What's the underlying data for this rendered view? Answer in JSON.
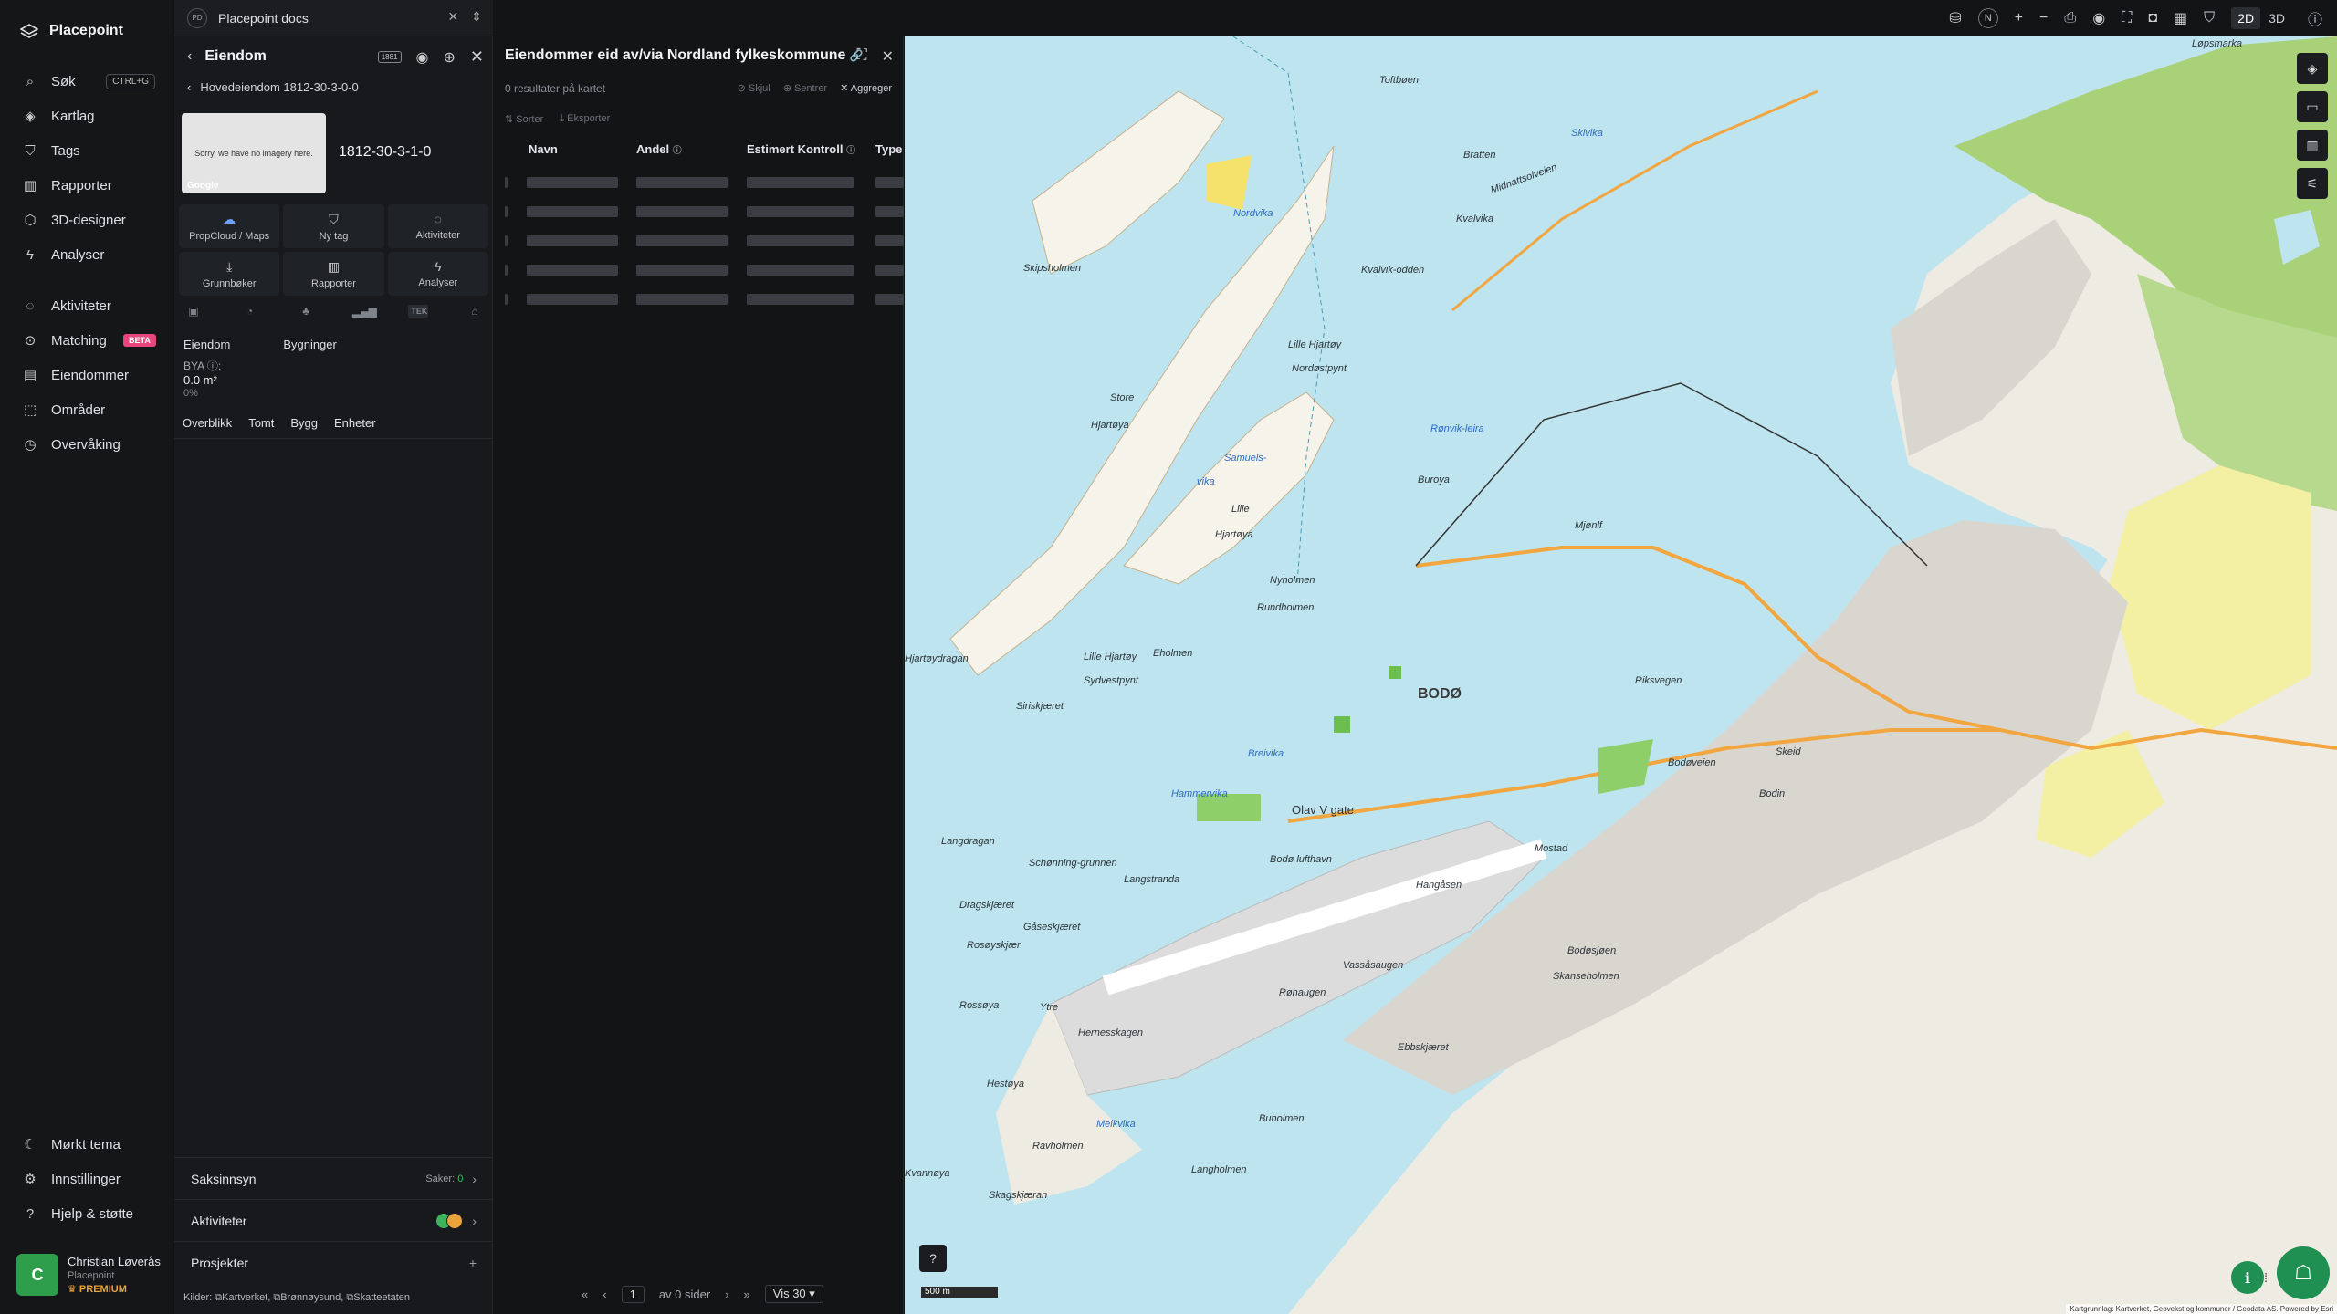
{
  "app": {
    "name": "Placepoint"
  },
  "sidebar": {
    "items": [
      {
        "label": "Søk",
        "icon": "search-icon",
        "shortcut": "CTRL+G"
      },
      {
        "label": "Kartlag",
        "icon": "layers-icon"
      },
      {
        "label": "Tags",
        "icon": "bookmark-icon"
      },
      {
        "label": "Rapporter",
        "icon": "chart-icon"
      },
      {
        "label": "3D-designer",
        "icon": "cube-icon"
      },
      {
        "label": "Analyser",
        "icon": "bolt-icon"
      },
      {
        "label": "Aktiviteter",
        "icon": "chat-icon"
      },
      {
        "label": "Matching",
        "icon": "match-icon",
        "badge": "BETA"
      },
      {
        "label": "Eiendommer",
        "icon": "building-icon"
      },
      {
        "label": "Områder",
        "icon": "area-icon"
      },
      {
        "label": "Overvåking",
        "icon": "monitor-icon"
      }
    ],
    "bottom": [
      {
        "label": "Mørkt tema",
        "icon": "moon-icon"
      },
      {
        "label": "Innstillinger",
        "icon": "gear-icon"
      },
      {
        "label": "Hjelp & støtte",
        "icon": "help-icon"
      }
    ],
    "user": {
      "initial": "C",
      "name": "Christian Løverås",
      "org": "Placepoint",
      "plan": "PREMIUM"
    }
  },
  "tab": {
    "badge": "PD",
    "title": "Placepoint docs"
  },
  "property": {
    "title": "Eiendom",
    "tag": "1881",
    "breadcrumb": "Hovedeiendom 1812-30-3-0-0",
    "thumbnail_text": "Sorry, we have no imagery here.",
    "thumbnail_brand": "Google",
    "id": "1812-30-3-1-0",
    "actions": [
      {
        "label": "PropCloud / Maps",
        "icon": "cloud-icon"
      },
      {
        "label": "Ny tag",
        "icon": "bookmark-icon"
      },
      {
        "label": "Aktiviteter",
        "icon": "chat-icon"
      },
      {
        "label": "Grunnbøker",
        "icon": "download-icon"
      },
      {
        "label": "Rapporter",
        "icon": "chart-icon"
      },
      {
        "label": "Analyser",
        "icon": "bolt-icon"
      }
    ],
    "icon_row_tek": "TEK",
    "section_eiendom": "Eiendom",
    "section_bygninger": "Bygninger",
    "bya_label": "BYA",
    "bya_value": "0.0 m²",
    "bya_percent": "0%",
    "subtabs": [
      "Overblikk",
      "Tomt",
      "Bygg",
      "Enheter"
    ],
    "sections": {
      "saksinnsyn": {
        "label": "Saksinnsyn",
        "meta_label": "Saker:",
        "meta_value": "0"
      },
      "aktiviteter": {
        "label": "Aktiviteter"
      },
      "prosjekter": {
        "label": "Prosjekter"
      }
    },
    "sources_label": "Kilder:",
    "sources": [
      "Kartverket,",
      "Brønnøysund,",
      "Skatteetaten"
    ]
  },
  "list": {
    "title": "Eiendommer eid av/via Nordland fylkeskommune",
    "count": "0 resultater på kartet",
    "tools": [
      "Skjul",
      "Sentrer",
      "Aggreger"
    ],
    "tools2": [
      "Sorter",
      "Eksporter"
    ],
    "columns": [
      "Navn",
      "Andel",
      "Estimert Kontroll",
      "Type"
    ],
    "pager": {
      "page": "1",
      "of": "av 0 sider",
      "show": "Vis 30"
    }
  },
  "map": {
    "mode_2d": "2D",
    "mode_3d": "3D",
    "north": "N",
    "city": "BODØ",
    "scale": "500 m",
    "labels": [
      {
        "t": "Toftbøen",
        "w": false
      },
      {
        "t": "Løpsmarka",
        "w": false
      },
      {
        "t": "Skipsholmen",
        "w": false
      },
      {
        "t": "Nordvika",
        "w": true
      },
      {
        "t": "Bratten",
        "w": false
      },
      {
        "t": "Kvalvika",
        "w": false
      },
      {
        "t": "Skivika",
        "w": true
      },
      {
        "t": "Midnattsolveien",
        "w": false
      },
      {
        "t": "Kvalvik-odden",
        "w": false
      },
      {
        "t": "Lille Hjartøy",
        "w": false
      },
      {
        "t": "Nordøstpynt",
        "w": false
      },
      {
        "t": "Hjartøya",
        "w": false
      },
      {
        "t": "Store",
        "w": false
      },
      {
        "t": "Samuels-",
        "w": true
      },
      {
        "t": "vika",
        "w": true
      },
      {
        "t": "Lille",
        "w": false
      },
      {
        "t": "Hjartøya",
        "w": false
      },
      {
        "t": "Nyholmen",
        "w": false
      },
      {
        "t": "Rundholmen",
        "w": false
      },
      {
        "t": "Buroya",
        "w": false
      },
      {
        "t": "Rønvik-leira",
        "w": true
      },
      {
        "t": "Hjartøydragan",
        "w": false
      },
      {
        "t": "Lille Hjartøy",
        "w": false
      },
      {
        "t": "Sydvestpynt",
        "w": false
      },
      {
        "t": "Eholmen",
        "w": false
      },
      {
        "t": "Siriskjæret",
        "w": false
      },
      {
        "t": "Breivika",
        "w": true
      },
      {
        "t": "Hammervika",
        "w": true
      },
      {
        "t": "Olav V gate",
        "w": false
      },
      {
        "t": "Langdragan",
        "w": false
      },
      {
        "t": "Schønning-grunnen",
        "w": false
      },
      {
        "t": "Langstranda",
        "w": false
      },
      {
        "t": "Bodø lufthavn",
        "w": false
      },
      {
        "t": "Dragskjæret",
        "w": false
      },
      {
        "t": "Gåseskjæret",
        "w": false
      },
      {
        "t": "Rosøyskjær",
        "w": false
      },
      {
        "t": "Rossøya",
        "w": false
      },
      {
        "t": "Ytre",
        "w": false
      },
      {
        "t": "Hernesskagen",
        "w": false
      },
      {
        "t": "Hestøya",
        "w": false
      },
      {
        "t": "Røhaugen",
        "w": false
      },
      {
        "t": "Vassåsaugen",
        "w": false
      },
      {
        "t": "Hangåsen",
        "w": false
      },
      {
        "t": "Mostad",
        "w": false
      },
      {
        "t": "Bodøsjøen",
        "w": false
      },
      {
        "t": "Skanseholmen",
        "w": false
      },
      {
        "t": "Ebbskjæret",
        "w": false
      },
      {
        "t": "Buholmen",
        "w": false
      },
      {
        "t": "Langholmen",
        "w": false
      },
      {
        "t": "Ravholmen",
        "w": false
      },
      {
        "t": "Skagskjæran",
        "w": false
      },
      {
        "t": "Kvannøya",
        "w": false
      },
      {
        "t": "Meikvika",
        "w": true
      },
      {
        "t": "Bodøveien",
        "w": false
      },
      {
        "t": "Mjønlf",
        "w": false
      },
      {
        "t": "Riksvegen",
        "w": false
      },
      {
        "t": "Skeid",
        "w": false
      },
      {
        "t": "Bodin",
        "w": false
      }
    ],
    "attribution": "Kartgrunnlag: Kartverket, Geovekst og kommuner / Geodata AS. Powered by Esri"
  }
}
